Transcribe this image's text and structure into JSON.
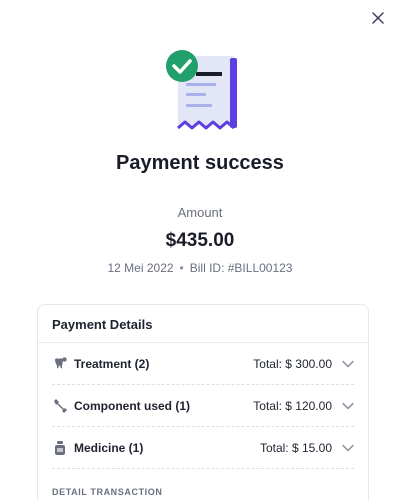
{
  "title": "Payment success",
  "amount": {
    "label": "Amount",
    "value": "$435.00"
  },
  "meta": {
    "date": "12 Mei 2022",
    "separator": "•",
    "bill_id": "Bill ID: #BILL00123"
  },
  "details": {
    "header": "Payment Details",
    "items": [
      {
        "label": "Treatment (2)",
        "total": "Total: $ 300.00",
        "icon": "tooth-icon"
      },
      {
        "label": "Component used (1)",
        "total": "Total: $ 120.00",
        "icon": "wrench-icon"
      },
      {
        "label": "Medicine (1)",
        "total": "Total: $ 15.00",
        "icon": "medicine-bottle-icon"
      }
    ],
    "transaction_header": "DETAIL TRANSACTION"
  },
  "colors": {
    "accent": "#5b3fe0",
    "success": "#22a06b",
    "receipt": "#e3e6f7"
  }
}
